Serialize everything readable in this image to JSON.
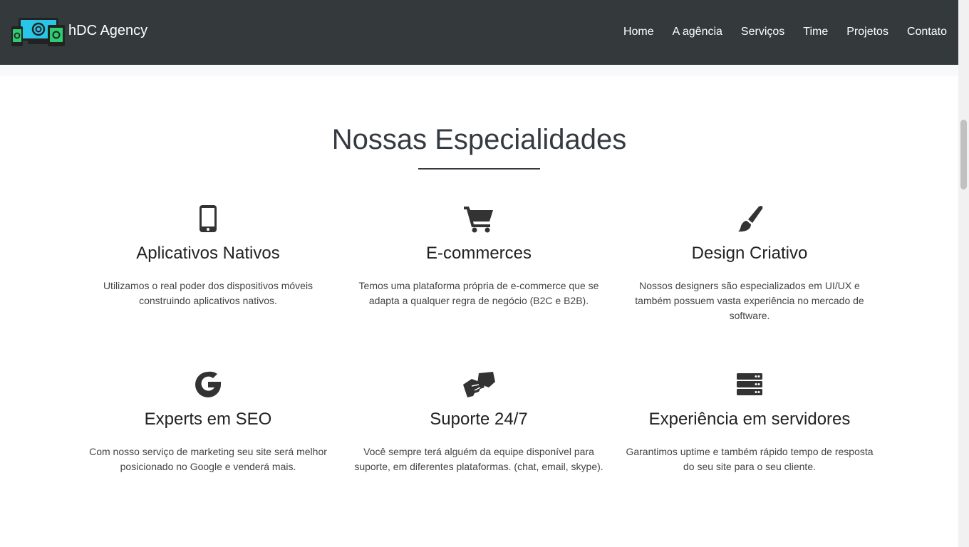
{
  "brand": {
    "name": "hDC Agency",
    "logo_icon": "devices-logo-icon"
  },
  "nav": {
    "items": [
      "Home",
      "A agência",
      "Serviços",
      "Time",
      "Projetos",
      "Contato"
    ]
  },
  "section": {
    "title": "Nossas Especialidades"
  },
  "services": [
    {
      "icon": "mobile-phone-icon",
      "title": "Aplicativos Nativos",
      "desc": "Utilizamos o real poder dos dispositivos móveis construindo aplicativos nativos."
    },
    {
      "icon": "shopping-cart-icon",
      "title": "E-commerces",
      "desc": "Temos uma plataforma própria de e-commerce que se adapta a qualquer regra de negócio (B2C e B2B)."
    },
    {
      "icon": "paint-brush-icon",
      "title": "Design Criativo",
      "desc": "Nossos designers são especializados em UI/UX e também possuem vasta experiência no mercado de software."
    },
    {
      "icon": "google-icon",
      "title": "Experts em SEO",
      "desc": "Com nosso serviço de marketing seu site será melhor posicionado no Google e venderá mais."
    },
    {
      "icon": "handshake-icon",
      "title": "Suporte 24/7",
      "desc": "Você sempre terá alguém da equipe disponível para suporte, em diferentes plataformas. (chat, email, skype)."
    },
    {
      "icon": "server-icon",
      "title": "Experiência em servidores",
      "desc": "Garantimos uptime e também rápido tempo de resposta do seu site para o seu cliente."
    }
  ],
  "colors": {
    "navbar": "#343a3c",
    "text_dark": "#343a40",
    "logo_cyan": "#29c5e6",
    "logo_green": "#2ecc71"
  }
}
